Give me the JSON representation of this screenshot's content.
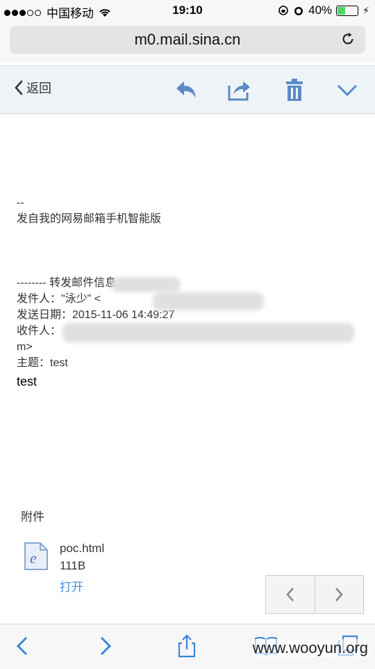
{
  "status": {
    "carrier": "中国移动",
    "time": "19:10",
    "battery": "40%"
  },
  "browser": {
    "url": "m0.mail.sina.cn"
  },
  "toolbar": {
    "back_label": "返回"
  },
  "mail": {
    "sep": "--",
    "signature": "发自我的网易邮箱手机智能版",
    "forward_header": "-------- 转发邮件信息",
    "from": "发件人：\"泳少\" <",
    "date": "发送日期：2015-11-06 14:49:27",
    "to": "收件人：",
    "to_tail": "m>",
    "subject": "主题：test",
    "body": "test"
  },
  "attachment": {
    "title": "附件",
    "file_name": "poc.html",
    "file_size": "111B",
    "open_label": "打开"
  },
  "watermark": "www.wooyun.org",
  "colors": {
    "accent": "#4a90d9",
    "icon_blue": "#5b8bc5"
  }
}
